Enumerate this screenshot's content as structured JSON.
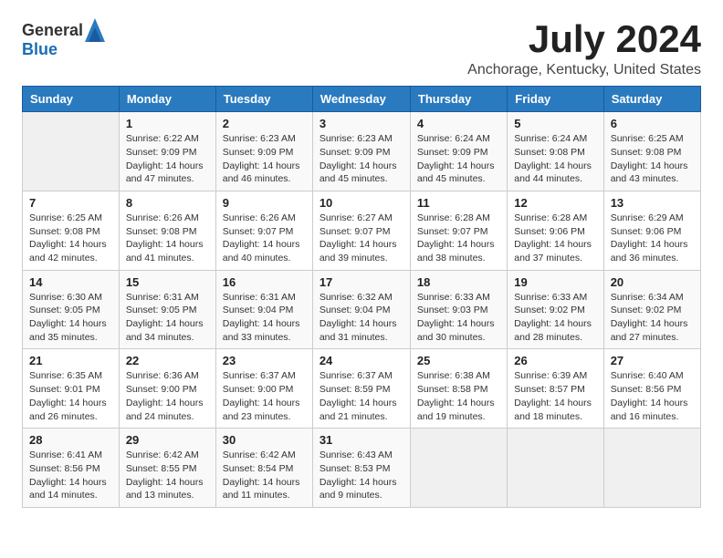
{
  "header": {
    "logo_general": "General",
    "logo_blue": "Blue",
    "month_title": "July 2024",
    "location": "Anchorage, Kentucky, United States"
  },
  "weekdays": [
    "Sunday",
    "Monday",
    "Tuesday",
    "Wednesday",
    "Thursday",
    "Friday",
    "Saturday"
  ],
  "weeks": [
    [
      {
        "day": "",
        "info": ""
      },
      {
        "day": "1",
        "info": "Sunrise: 6:22 AM\nSunset: 9:09 PM\nDaylight: 14 hours\nand 47 minutes."
      },
      {
        "day": "2",
        "info": "Sunrise: 6:23 AM\nSunset: 9:09 PM\nDaylight: 14 hours\nand 46 minutes."
      },
      {
        "day": "3",
        "info": "Sunrise: 6:23 AM\nSunset: 9:09 PM\nDaylight: 14 hours\nand 45 minutes."
      },
      {
        "day": "4",
        "info": "Sunrise: 6:24 AM\nSunset: 9:09 PM\nDaylight: 14 hours\nand 45 minutes."
      },
      {
        "day": "5",
        "info": "Sunrise: 6:24 AM\nSunset: 9:08 PM\nDaylight: 14 hours\nand 44 minutes."
      },
      {
        "day": "6",
        "info": "Sunrise: 6:25 AM\nSunset: 9:08 PM\nDaylight: 14 hours\nand 43 minutes."
      }
    ],
    [
      {
        "day": "7",
        "info": "Sunrise: 6:25 AM\nSunset: 9:08 PM\nDaylight: 14 hours\nand 42 minutes."
      },
      {
        "day": "8",
        "info": "Sunrise: 6:26 AM\nSunset: 9:08 PM\nDaylight: 14 hours\nand 41 minutes."
      },
      {
        "day": "9",
        "info": "Sunrise: 6:26 AM\nSunset: 9:07 PM\nDaylight: 14 hours\nand 40 minutes."
      },
      {
        "day": "10",
        "info": "Sunrise: 6:27 AM\nSunset: 9:07 PM\nDaylight: 14 hours\nand 39 minutes."
      },
      {
        "day": "11",
        "info": "Sunrise: 6:28 AM\nSunset: 9:07 PM\nDaylight: 14 hours\nand 38 minutes."
      },
      {
        "day": "12",
        "info": "Sunrise: 6:28 AM\nSunset: 9:06 PM\nDaylight: 14 hours\nand 37 minutes."
      },
      {
        "day": "13",
        "info": "Sunrise: 6:29 AM\nSunset: 9:06 PM\nDaylight: 14 hours\nand 36 minutes."
      }
    ],
    [
      {
        "day": "14",
        "info": "Sunrise: 6:30 AM\nSunset: 9:05 PM\nDaylight: 14 hours\nand 35 minutes."
      },
      {
        "day": "15",
        "info": "Sunrise: 6:31 AM\nSunset: 9:05 PM\nDaylight: 14 hours\nand 34 minutes."
      },
      {
        "day": "16",
        "info": "Sunrise: 6:31 AM\nSunset: 9:04 PM\nDaylight: 14 hours\nand 33 minutes."
      },
      {
        "day": "17",
        "info": "Sunrise: 6:32 AM\nSunset: 9:04 PM\nDaylight: 14 hours\nand 31 minutes."
      },
      {
        "day": "18",
        "info": "Sunrise: 6:33 AM\nSunset: 9:03 PM\nDaylight: 14 hours\nand 30 minutes."
      },
      {
        "day": "19",
        "info": "Sunrise: 6:33 AM\nSunset: 9:02 PM\nDaylight: 14 hours\nand 28 minutes."
      },
      {
        "day": "20",
        "info": "Sunrise: 6:34 AM\nSunset: 9:02 PM\nDaylight: 14 hours\nand 27 minutes."
      }
    ],
    [
      {
        "day": "21",
        "info": "Sunrise: 6:35 AM\nSunset: 9:01 PM\nDaylight: 14 hours\nand 26 minutes."
      },
      {
        "day": "22",
        "info": "Sunrise: 6:36 AM\nSunset: 9:00 PM\nDaylight: 14 hours\nand 24 minutes."
      },
      {
        "day": "23",
        "info": "Sunrise: 6:37 AM\nSunset: 9:00 PM\nDaylight: 14 hours\nand 23 minutes."
      },
      {
        "day": "24",
        "info": "Sunrise: 6:37 AM\nSunset: 8:59 PM\nDaylight: 14 hours\nand 21 minutes."
      },
      {
        "day": "25",
        "info": "Sunrise: 6:38 AM\nSunset: 8:58 PM\nDaylight: 14 hours\nand 19 minutes."
      },
      {
        "day": "26",
        "info": "Sunrise: 6:39 AM\nSunset: 8:57 PM\nDaylight: 14 hours\nand 18 minutes."
      },
      {
        "day": "27",
        "info": "Sunrise: 6:40 AM\nSunset: 8:56 PM\nDaylight: 14 hours\nand 16 minutes."
      }
    ],
    [
      {
        "day": "28",
        "info": "Sunrise: 6:41 AM\nSunset: 8:56 PM\nDaylight: 14 hours\nand 14 minutes."
      },
      {
        "day": "29",
        "info": "Sunrise: 6:42 AM\nSunset: 8:55 PM\nDaylight: 14 hours\nand 13 minutes."
      },
      {
        "day": "30",
        "info": "Sunrise: 6:42 AM\nSunset: 8:54 PM\nDaylight: 14 hours\nand 11 minutes."
      },
      {
        "day": "31",
        "info": "Sunrise: 6:43 AM\nSunset: 8:53 PM\nDaylight: 14 hours\nand 9 minutes."
      },
      {
        "day": "",
        "info": ""
      },
      {
        "day": "",
        "info": ""
      },
      {
        "day": "",
        "info": ""
      }
    ]
  ]
}
